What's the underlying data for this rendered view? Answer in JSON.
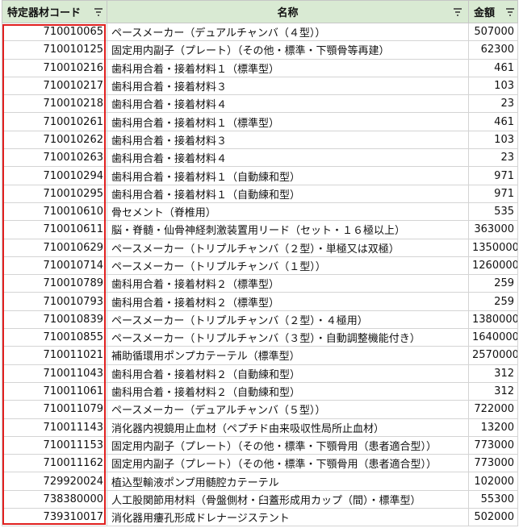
{
  "columns": {
    "code_header": "特定器材コード",
    "name_header": "名称",
    "amount_header": "金額"
  },
  "icons": {
    "filter": "filter-icon"
  },
  "colors": {
    "header_bg": "#d9ead3",
    "selection_border": "#e0201f"
  },
  "rows": [
    {
      "code": "710010065",
      "name": "ペースメーカー（デュアルチャンバ（４型））",
      "amount": "507000"
    },
    {
      "code": "710010125",
      "name": "固定用内副子（プレート）（その他・標準・下顎骨等再建）",
      "amount": "62300"
    },
    {
      "code": "710010216",
      "name": "歯科用合着・接着材料１（標準型）",
      "amount": "461"
    },
    {
      "code": "710010217",
      "name": "歯科用合着・接着材料３",
      "amount": "103"
    },
    {
      "code": "710010218",
      "name": "歯科用合着・接着材料４",
      "amount": "23"
    },
    {
      "code": "710010261",
      "name": "歯科用合着・接着材料１（標準型）",
      "amount": "461"
    },
    {
      "code": "710010262",
      "name": "歯科用合着・接着材料３",
      "amount": "103"
    },
    {
      "code": "710010263",
      "name": "歯科用合着・接着材料４",
      "amount": "23"
    },
    {
      "code": "710010294",
      "name": "歯科用合着・接着材料１（自動練和型）",
      "amount": "971"
    },
    {
      "code": "710010295",
      "name": "歯科用合着・接着材料１（自動練和型）",
      "amount": "971"
    },
    {
      "code": "710010610",
      "name": "骨セメント（脊椎用）",
      "amount": "535"
    },
    {
      "code": "710010611",
      "name": "脳・脊髄・仙骨神経刺激装置用リード（セット・１６極以上）",
      "amount": "363000"
    },
    {
      "code": "710010629",
      "name": "ペースメーカー（トリプルチャンバ（２型）・単極又は双極）",
      "amount": "1350000"
    },
    {
      "code": "710010714",
      "name": "ペースメーカー（トリプルチャンバ（１型））",
      "amount": "1260000"
    },
    {
      "code": "710010789",
      "name": "歯科用合着・接着材料２（標準型）",
      "amount": "259"
    },
    {
      "code": "710010793",
      "name": "歯科用合着・接着材料２（標準型）",
      "amount": "259"
    },
    {
      "code": "710010839",
      "name": "ペースメーカー（トリプルチャンバ（２型）・４極用）",
      "amount": "1380000"
    },
    {
      "code": "710010855",
      "name": "ペースメーカー（トリプルチャンバ（３型）・自動調整機能付き）",
      "amount": "1640000"
    },
    {
      "code": "710011021",
      "name": "補助循環用ポンプカテーテル（標準型）",
      "amount": "2570000"
    },
    {
      "code": "710011043",
      "name": "歯科用合着・接着材料２（自動練和型）",
      "amount": "312"
    },
    {
      "code": "710011061",
      "name": "歯科用合着・接着材料２（自動練和型）",
      "amount": "312"
    },
    {
      "code": "710011079",
      "name": "ペースメーカー（デュアルチャンバ（５型））",
      "amount": "722000"
    },
    {
      "code": "710011143",
      "name": "消化器内視鏡用止血材（ペプチド由来吸収性局所止血材）",
      "amount": "13200"
    },
    {
      "code": "710011153",
      "name": "固定用内副子（プレート）（その他・標準・下顎骨用（患者適合型））",
      "amount": "773000"
    },
    {
      "code": "710011162",
      "name": "固定用内副子（プレート）（その他・標準・下顎骨用（患者適合型））",
      "amount": "773000"
    },
    {
      "code": "729920024",
      "name": "植込型輸液ポンプ用髄腔カテーテル",
      "amount": "102000"
    },
    {
      "code": "738380000",
      "name": "人工股関節用材料（骨盤側材・臼蓋形成用カップ（間）・標準型）",
      "amount": "55300"
    },
    {
      "code": "739310017",
      "name": "消化器用瘻孔形成ドレナージステント",
      "amount": "502000"
    }
  ]
}
